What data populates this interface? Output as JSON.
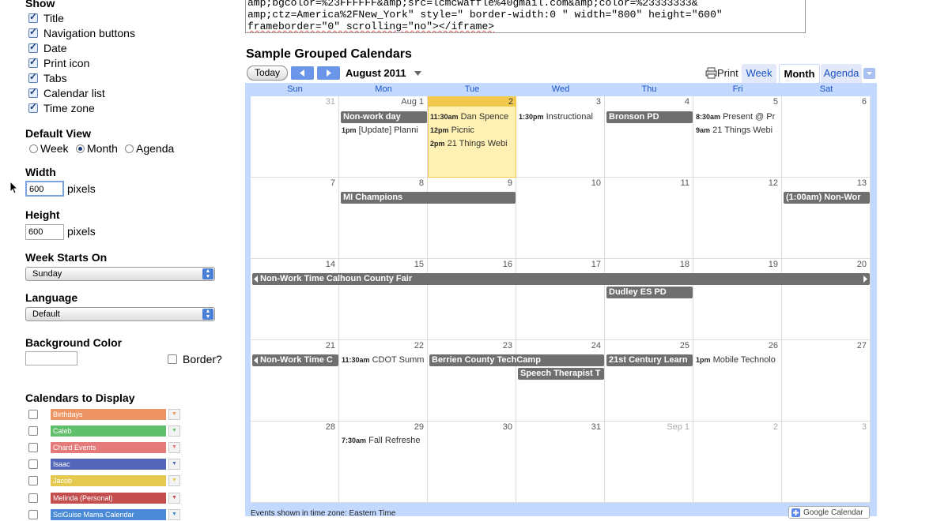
{
  "settings": {
    "show_label": "Show",
    "show_items": [
      "Title",
      "Navigation buttons",
      "Date",
      "Print icon",
      "Tabs",
      "Calendar list",
      "Time zone"
    ],
    "default_view_label": "Default View",
    "default_view_options": [
      "Week",
      "Month",
      "Agenda"
    ],
    "width_label": "Width",
    "width_value": "600",
    "height_label": "Height",
    "height_value": "600",
    "pixels": "pixels",
    "week_starts_label": "Week Starts On",
    "week_starts_value": "Sunday",
    "language_label": "Language",
    "language_value": "Default",
    "bg_label": "Background Color",
    "border_label": "Border?",
    "calendars_label": "Calendars to Display",
    "calendars": [
      {
        "name": "Birthdays",
        "color": "#ee9464"
      },
      {
        "name": "Caleb",
        "color": "#5fbf6a"
      },
      {
        "name": "Chard Events",
        "color": "#e57a7a"
      },
      {
        "name": "Isaac",
        "color": "#5466b8"
      },
      {
        "name": "Jacob",
        "color": "#e5c94e"
      },
      {
        "name": "Melinda (Personal)",
        "color": "#c44e4e"
      },
      {
        "name": "SciGuise Mama Calendar",
        "color": "#4a8ad6"
      }
    ]
  },
  "code": {
    "line1": "amp;bgcolor=%23FFFFFF&amp;src=lcmcwaffle%40gmail.com&amp;color=%23333333&",
    "line2": "amp;ctz=America%2FNew_York\" style=\" border-width:0 \" width=\"800\" height=\"600\"",
    "line3": "frameborder=\"0\" scrolling=\"no\"></iframe>"
  },
  "calendar": {
    "title": "Sample Grouped Calendars",
    "today_label": "Today",
    "month_label": "August 2011",
    "print_label": "Print",
    "tabs": [
      "Week",
      "Month",
      "Agenda"
    ],
    "weekdays": [
      "Sun",
      "Mon",
      "Tue",
      "Wed",
      "Thu",
      "Fri",
      "Sat"
    ],
    "weeks": [
      [
        "31",
        "Aug 1",
        "2",
        "3",
        "4",
        "5",
        "6"
      ],
      [
        "7",
        "8",
        "9",
        "10",
        "11",
        "12",
        "13"
      ],
      [
        "14",
        "15",
        "16",
        "17",
        "18",
        "19",
        "20"
      ],
      [
        "21",
        "22",
        "23",
        "24",
        "25",
        "26",
        "27"
      ],
      [
        "28",
        "29",
        "30",
        "31",
        "Sep 1",
        "2",
        "3"
      ]
    ],
    "events": {
      "nonwork": "Non-work day",
      "update": "[Update] Planni",
      "update_t": "1pm",
      "dan": "Dan Spence",
      "dan_t": "11:30am",
      "picnic": "Picnic",
      "picnic_t": "12pm",
      "things": "21 Things Webi",
      "things_t": "2pm",
      "instr": "Instructional",
      "instr_t": "1:30pm",
      "bronson": "Bronson PD",
      "present": "Present @ Pr",
      "present_t": "8:30am",
      "things2": "21 Things Webi",
      "things2_t": "9am",
      "mi": "MI Champions",
      "nonwd": "(1:00am) Non-Wor",
      "calhoun": "Non-Work Time Calhoun County Fair",
      "dudley": "Dudley ES PD",
      "nonworkc": "Non-Work Time C",
      "cdot": "CDOT Summ",
      "cdot_t": "11:30am",
      "berrien": "Berrien County TechCamp",
      "speech": "Speech Therapist T",
      "century": "21st Century Learn",
      "mobile": "Mobile Technolo",
      "mobile_t": "1pm",
      "fall": "Fall Refreshe",
      "fall_t": "7:30am"
    },
    "footer": "Events shown in time zone: Eastern Time",
    "google_label": "Google Calendar"
  }
}
